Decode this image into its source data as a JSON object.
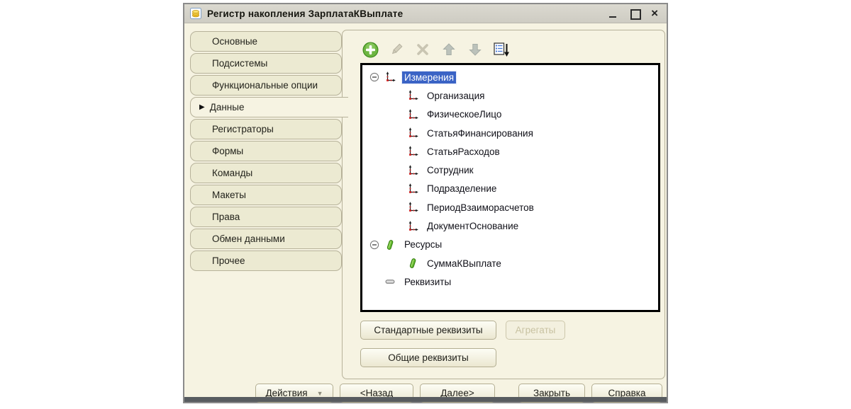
{
  "window": {
    "title": "Регистр накопления ЗарплатаКВыплате",
    "controls": [
      {
        "id": "minimize",
        "name": "minimize-button"
      },
      {
        "id": "maximize",
        "name": "maximize-button"
      },
      {
        "id": "close",
        "name": "close-button",
        "glyph": "×"
      }
    ]
  },
  "tabs": [
    {
      "id": "osnovnye",
      "label": "Основные",
      "selected": false
    },
    {
      "id": "podsistemy",
      "label": "Подсистемы",
      "selected": false
    },
    {
      "id": "funkcionalnye-opcii",
      "label": "Функциональные опции",
      "selected": false
    },
    {
      "id": "dannye",
      "label": "Данные",
      "selected": true
    },
    {
      "id": "registratory",
      "label": "Регистраторы",
      "selected": false
    },
    {
      "id": "formy",
      "label": "Формы",
      "selected": false
    },
    {
      "id": "komandy",
      "label": "Команды",
      "selected": false
    },
    {
      "id": "makety",
      "label": "Макеты",
      "selected": false
    },
    {
      "id": "prava",
      "label": "Права",
      "selected": false
    },
    {
      "id": "obmen-dannymi",
      "label": "Обмен данными",
      "selected": false
    },
    {
      "id": "prochee",
      "label": "Прочее",
      "selected": false
    }
  ],
  "selected_tab_marker": "▶",
  "toolbar": [
    {
      "id": "add",
      "icon": "add-icon",
      "enabled": true
    },
    {
      "id": "edit",
      "icon": "pencil-icon",
      "enabled": false
    },
    {
      "id": "delete",
      "icon": "delete-icon",
      "enabled": false
    },
    {
      "id": "move-up",
      "icon": "arrow-up-icon",
      "enabled": false
    },
    {
      "id": "move-down",
      "icon": "arrow-down-icon",
      "enabled": false
    },
    {
      "id": "sort-order",
      "icon": "sort-list-icon",
      "enabled": true
    }
  ],
  "tree": [
    {
      "label": "Измерения",
      "level": 0,
      "icon": "dimension",
      "expander": true,
      "selected": true
    },
    {
      "label": "Организация",
      "level": 1,
      "icon": "dimension",
      "expander": false,
      "selected": false
    },
    {
      "label": "ФизическоеЛицо",
      "level": 1,
      "icon": "dimension",
      "expander": false,
      "selected": false
    },
    {
      "label": "СтатьяФинансирования",
      "level": 1,
      "icon": "dimension",
      "expander": false,
      "selected": false
    },
    {
      "label": "СтатьяРасходов",
      "level": 1,
      "icon": "dimension",
      "expander": false,
      "selected": false
    },
    {
      "label": "Сотрудник",
      "level": 1,
      "icon": "dimension",
      "expander": false,
      "selected": false
    },
    {
      "label": "Подразделение",
      "level": 1,
      "icon": "dimension",
      "expander": false,
      "selected": false
    },
    {
      "label": "ПериодВзаиморасчетов",
      "level": 1,
      "icon": "dimension",
      "expander": false,
      "selected": false
    },
    {
      "label": "ДокументОснование",
      "level": 1,
      "icon": "dimension",
      "expander": false,
      "selected": false
    },
    {
      "label": "Ресурсы",
      "level": 0,
      "icon": "resource",
      "expander": true,
      "selected": false
    },
    {
      "label": "СуммаКВыплате",
      "level": 1,
      "icon": "resource",
      "expander": false,
      "selected": false
    },
    {
      "label": "Реквизиты",
      "level": 0,
      "icon": "attribute",
      "expander": false,
      "selected": false
    }
  ],
  "panel_buttons": [
    {
      "id": "standard-attributes",
      "label": "Стандартные реквизиты",
      "enabled": true,
      "row": 1,
      "w": "w-std"
    },
    {
      "id": "aggregates",
      "label": "Агрегаты",
      "enabled": false,
      "row": 1,
      "w": "w-agg"
    },
    {
      "id": "common-attributes",
      "label": "Общие реквизиты",
      "enabled": true,
      "row": 2,
      "w": "w-common"
    }
  ],
  "bottom_buttons": [
    {
      "id": "actions",
      "label": "Действия",
      "dropdown": true,
      "w": "w-actions"
    },
    {
      "id": "back",
      "label": "<Назад",
      "dropdown": false,
      "w": "w-back"
    },
    {
      "id": "next",
      "label": "Далее>",
      "dropdown": false,
      "w": "w-next"
    },
    {
      "id": "close",
      "label": "Закрыть",
      "dropdown": false,
      "w": "w-close",
      "pregap": true
    },
    {
      "id": "help",
      "label": "Справка",
      "dropdown": false,
      "w": "w-help"
    }
  ],
  "colors": {
    "selection_blue": "#3a63c5",
    "window_cream": "#f6f3e2",
    "tab_cream": "#ecead2",
    "titlebar_gray": "#d4d2c9",
    "accent_green": "#5fae2f",
    "tree_border": "#000000"
  }
}
